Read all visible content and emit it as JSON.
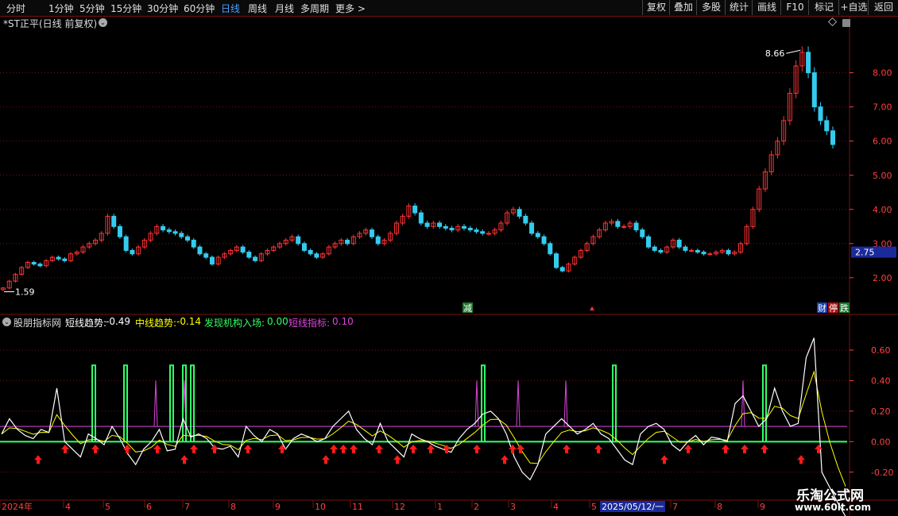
{
  "period_tabs": [
    {
      "label": "分时",
      "active": false
    },
    {
      "label": "1分钟",
      "active": false
    },
    {
      "label": "5分钟",
      "active": false
    },
    {
      "label": "15分钟",
      "active": false
    },
    {
      "label": "30分钟",
      "active": false
    },
    {
      "label": "60分钟",
      "active": false
    },
    {
      "label": "日线",
      "active": true
    },
    {
      "label": "周线",
      "active": false
    },
    {
      "label": "月线",
      "active": false
    },
    {
      "label": "多周期",
      "active": false
    },
    {
      "label": "更多",
      "active": false
    }
  ],
  "right_buttons": [
    "复权",
    "叠加",
    "多股",
    "统计",
    "画线",
    "F10",
    "标记",
    "+自选",
    "返回"
  ],
  "stock_title": "*ST正平(日线 前复权)",
  "price_axis": [
    "8.00",
    "7.00",
    "6.00",
    "5.00",
    "4.00",
    "3.00",
    "2.00"
  ],
  "current_price": "2.75",
  "max_label": "8.66",
  "min_label": "1.59",
  "tags": {
    "reduce": "减",
    "limit_up": "停",
    "finance": "财",
    "fall": "跌"
  },
  "indicator": {
    "name": "股朋指标网",
    "items": [
      {
        "label": "短线趋势:",
        "value": "-0.49",
        "color": "#ffffff"
      },
      {
        "label": "中线趋势:",
        "value": "-0.14",
        "color": "#ffff00"
      },
      {
        "label": "发现机构入场:",
        "value": "0.00",
        "color": "#33ff66"
      },
      {
        "label": "短线指标:",
        "value": "0.10",
        "color": "#dd44dd"
      }
    ],
    "axis": [
      "0.60",
      "0.40",
      "0.20",
      "0.00",
      "-0.20"
    ]
  },
  "time_axis": [
    "2024年",
    "4",
    "5",
    "6",
    "7",
    "8",
    "9",
    "10",
    "11",
    "12",
    "1",
    "2",
    "3",
    "4",
    "5",
    "7",
    "8",
    "9"
  ],
  "cursor_date": "2025/05/12/一",
  "watermark": {
    "line1": "乐淘公式网",
    "line2": "www.60lt.com"
  },
  "colors": {
    "up": "#ff3333",
    "down": "#33ccee",
    "grid": "#7a1010",
    "axis_text": "#ff4040"
  },
  "chart_data": {
    "type": "candlestick",
    "price_range": [
      1.3,
      9.2
    ],
    "indicator_range": [
      -0.3,
      0.73
    ],
    "close": [
      1.7,
      1.9,
      2.1,
      2.3,
      2.45,
      2.4,
      2.35,
      2.5,
      2.6,
      2.55,
      2.5,
      2.7,
      2.75,
      2.9,
      3.0,
      3.1,
      3.3,
      3.8,
      3.5,
      3.2,
      2.8,
      2.7,
      2.9,
      3.1,
      3.3,
      3.5,
      3.4,
      3.35,
      3.3,
      3.2,
      3.1,
      2.9,
      2.7,
      2.6,
      2.4,
      2.6,
      2.7,
      2.8,
      2.9,
      2.75,
      2.6,
      2.5,
      2.7,
      2.8,
      2.9,
      3.0,
      3.1,
      3.2,
      3.0,
      2.8,
      2.7,
      2.6,
      2.7,
      2.9,
      3.0,
      3.1,
      3.0,
      3.2,
      3.3,
      3.4,
      3.2,
      3.0,
      3.1,
      3.3,
      3.6,
      3.8,
      4.1,
      3.9,
      3.6,
      3.5,
      3.6,
      3.5,
      3.45,
      3.4,
      3.5,
      3.45,
      3.4,
      3.35,
      3.3,
      3.3,
      3.4,
      3.6,
      3.9,
      4.0,
      3.8,
      3.6,
      3.3,
      3.2,
      3.0,
      2.7,
      2.3,
      2.2,
      2.4,
      2.6,
      2.8,
      3.0,
      3.2,
      3.4,
      3.6,
      3.65,
      3.5,
      3.5,
      3.6,
      3.4,
      3.2,
      2.9,
      2.8,
      2.75,
      2.9,
      3.1,
      2.9,
      2.8,
      2.8,
      2.75,
      2.7,
      2.7,
      2.75,
      2.8,
      2.7,
      2.75,
      3.0,
      3.5,
      4.0,
      4.6,
      5.1,
      5.6,
      6.0,
      6.6,
      7.4,
      8.2,
      8.6,
      8.0,
      7.0,
      6.6,
      6.3,
      5.9
    ],
    "short_trend": [
      0.05,
      0.15,
      0.08,
      0.04,
      0.02,
      0.08,
      0.06,
      0.35,
      0.0,
      -0.05,
      -0.1,
      0.05,
      0.02,
      -0.02,
      0.1,
      0.02,
      -0.08,
      -0.15,
      -0.05,
      0.0,
      0.08,
      -0.06,
      -0.05,
      0.15,
      0.03,
      0.05,
      0.02,
      -0.04,
      -0.05,
      -0.03,
      -0.1,
      0.1,
      0.04,
      0.0,
      0.08,
      0.05,
      -0.05,
      0.02,
      0.05,
      0.03,
      0.0,
      0.02,
      0.1,
      0.15,
      0.2,
      0.08,
      0.02,
      -0.02,
      0.12,
      0.0,
      -0.05,
      -0.1,
      0.05,
      0.02,
      0.0,
      -0.03,
      -0.05,
      -0.07,
      0.02,
      0.08,
      0.12,
      0.18,
      0.2,
      0.15,
      0.05,
      -0.1,
      -0.2,
      -0.25,
      -0.15,
      0.05,
      0.1,
      0.15,
      0.1,
      0.05,
      0.08,
      0.12,
      0.05,
      0.02,
      -0.05,
      -0.12,
      -0.15,
      0.05,
      0.1,
      0.12,
      0.08,
      -0.02,
      -0.06,
      0.0,
      0.04,
      -0.02,
      0.03,
      0.02,
      0.0,
      0.25,
      0.3,
      0.2,
      0.1,
      0.15,
      0.35,
      0.2,
      0.1,
      0.12,
      0.55,
      0.68,
      -0.2,
      -0.3,
      -0.4,
      -0.49
    ]
  }
}
